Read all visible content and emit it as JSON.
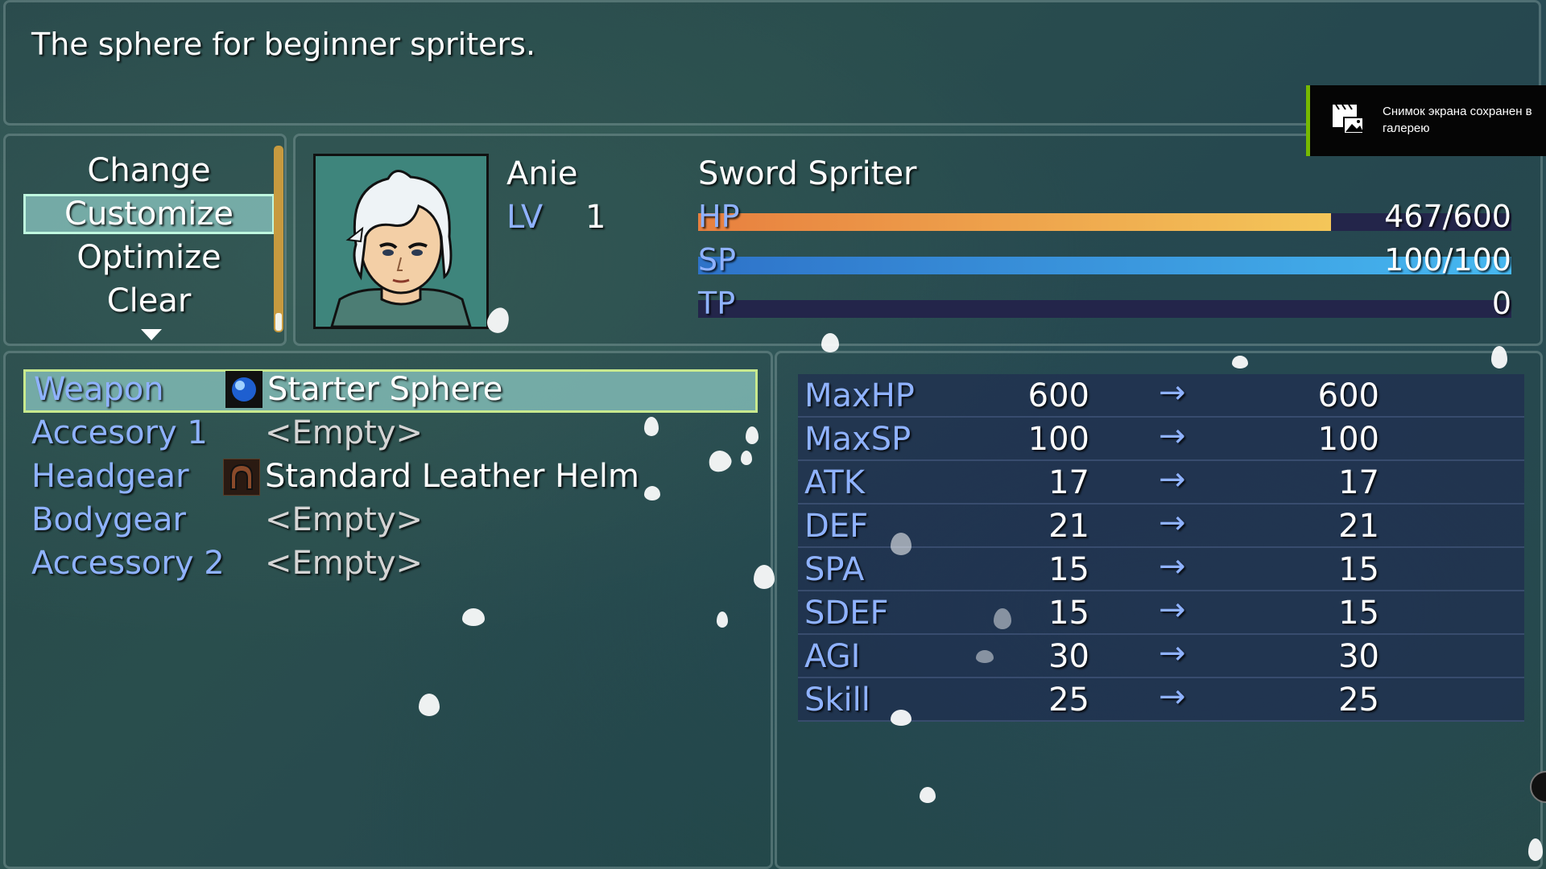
{
  "help": {
    "text": "The sphere for beginner spriters."
  },
  "commands": {
    "items": [
      "Change",
      "Customize",
      "Optimize",
      "Clear"
    ],
    "selected": "Customize"
  },
  "actor": {
    "name": "Anie",
    "lv_label": "LV",
    "level": "1",
    "class": "Sword Spriter",
    "hp": {
      "label": "HP",
      "value": "467/600",
      "fraction": 0.778
    },
    "sp": {
      "label": "SP",
      "value": "100/100",
      "fraction": 1.0
    },
    "tp": {
      "label": "TP",
      "value": "0",
      "fraction": 0.0
    }
  },
  "equipment": {
    "slots": [
      {
        "slot": "Weapon",
        "item": "Starter Sphere",
        "icon": "blue-orb-icon",
        "selected": true
      },
      {
        "slot": "Accesory 1",
        "item": "<Empty>",
        "icon": ""
      },
      {
        "slot": "Headgear",
        "item": "Standard Leather Helm",
        "icon": "leather-helm-icon"
      },
      {
        "slot": "Bodygear",
        "item": "<Empty>",
        "icon": ""
      },
      {
        "slot": "Accessory 2",
        "item": "<Empty>",
        "icon": ""
      }
    ]
  },
  "params": {
    "arrow": "→",
    "rows": [
      {
        "name": "MaxHP",
        "old": "600",
        "new": "600"
      },
      {
        "name": "MaxSP",
        "old": "100",
        "new": "100"
      },
      {
        "name": "ATK",
        "old": "17",
        "new": "17"
      },
      {
        "name": "DEF",
        "old": "21",
        "new": "21"
      },
      {
        "name": "SPA",
        "old": "15",
        "new": "15"
      },
      {
        "name": "SDEF",
        "old": "15",
        "new": "15"
      },
      {
        "name": "AGI",
        "old": "30",
        "new": "30"
      },
      {
        "name": "Skill",
        "old": "25",
        "new": "25"
      }
    ]
  },
  "toast": {
    "text": "Снимок экрана сохранен в галерею",
    "accent": "#76b900",
    "icon": "clapperboard-gallery-icon"
  },
  "colors": {
    "system_blue": "#8fb2ff",
    "hp_gradient": [
      "#e8803f",
      "#f4c659"
    ],
    "sp_gradient": [
      "#2e73c9",
      "#46b8f0"
    ],
    "gauge_back": "#23254a"
  }
}
